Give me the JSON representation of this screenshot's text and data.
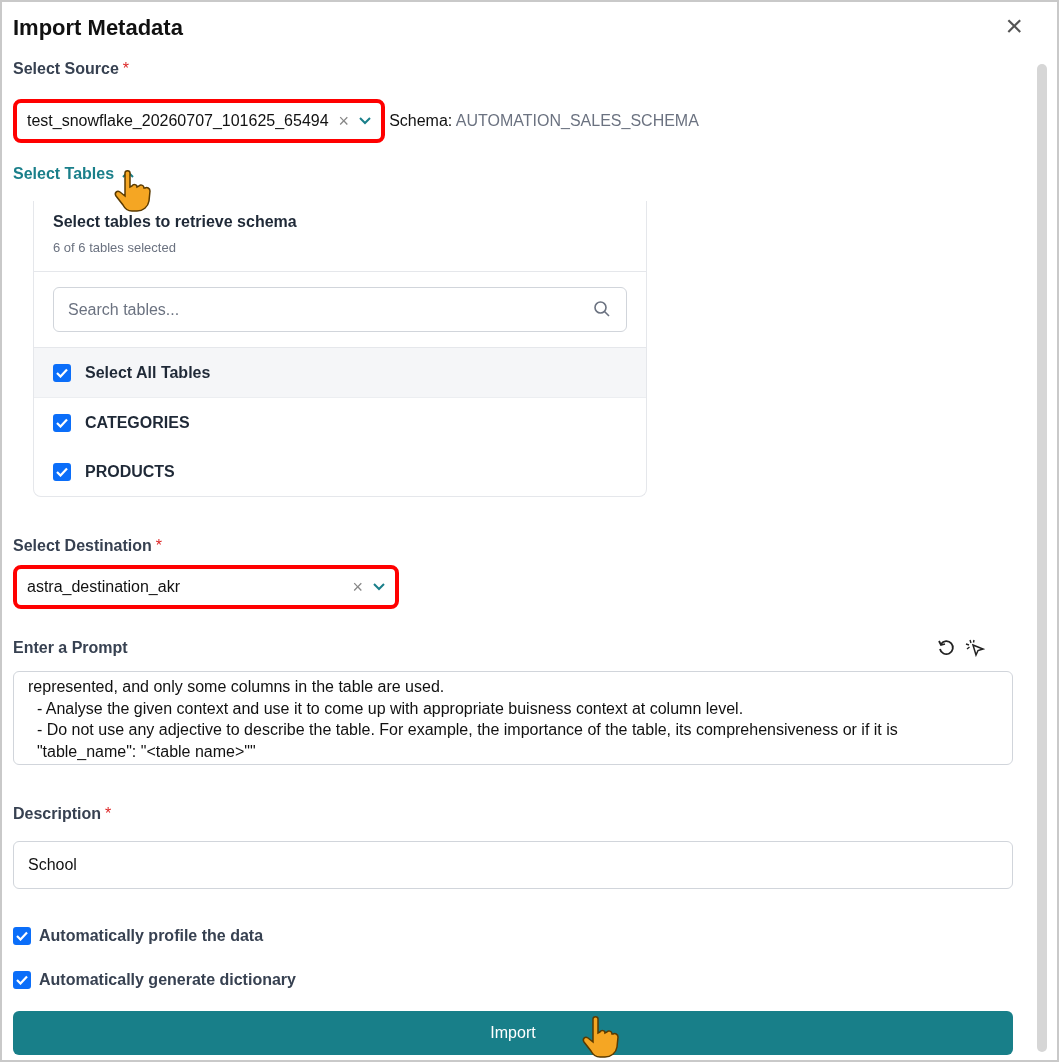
{
  "dialog": {
    "title": "Import Metadata",
    "close": "×"
  },
  "source": {
    "label": "Select Source",
    "required": "*",
    "value": "test_snowflake_20260707_101625_65494",
    "clear": "×",
    "schema_label": "Schema:",
    "schema_value": "AUTOMATION_SALES_SCHEMA"
  },
  "tables": {
    "toggle": "Select Tables",
    "expanded": true,
    "heading": "Select tables to retrieve schema",
    "count": "6 of 6 tables selected",
    "search": {
      "placeholder": "Search tables..."
    },
    "items": [
      {
        "label": "Select All Tables",
        "checked": true,
        "kind": "all"
      },
      {
        "label": "CATEGORIES",
        "checked": true,
        "kind": "table"
      },
      {
        "label": "PRODUCTS",
        "checked": true,
        "kind": "table"
      }
    ]
  },
  "destination": {
    "label": "Select Destination",
    "required": "*",
    "value": "astra_destination_akr",
    "clear": "×"
  },
  "prompt": {
    "label": "Enter a Prompt",
    "lines": [
      "represented, and only some columns in the table are used.",
      "  - Analyse the given context and use it to come up with appropriate buisness context at column level.",
      "  - Do not use any adjective to describe the table. For example, the importance of the table, its comprehensiveness or if it is",
      "  \"table_name\": \"<table name>\"\""
    ]
  },
  "description": {
    "label": "Description",
    "required": "*",
    "value": "School"
  },
  "options": [
    {
      "label": "Automatically profile the data",
      "checked": true
    },
    {
      "label": "Automatically generate dictionary",
      "checked": true
    }
  ],
  "import_button": "Import"
}
